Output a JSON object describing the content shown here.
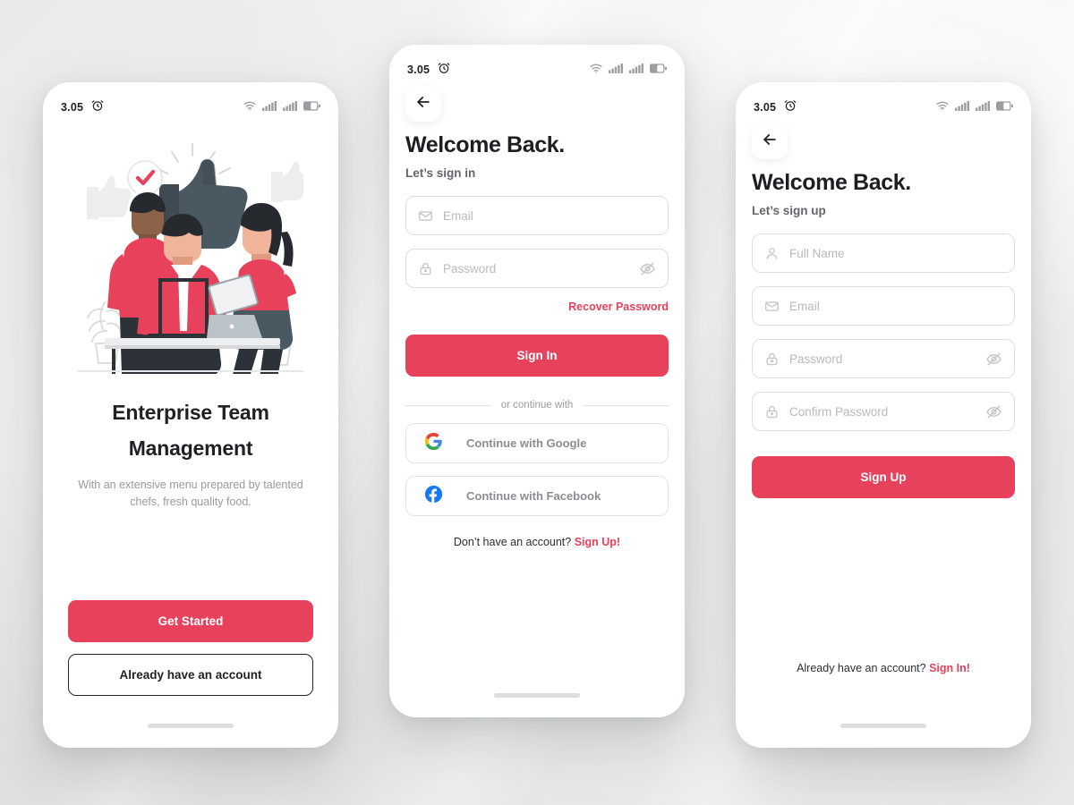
{
  "theme": {
    "accent": "#e8415c",
    "text_dark": "#1f2125",
    "text_muted": "#9a9a9f",
    "border": "#dedfe1",
    "background": "#ecedee"
  },
  "status_bar": {
    "time": "3.05",
    "alarm_icon": "alarm-clock-icon",
    "wifi_icon": "wifi-icon",
    "signal_icon_1": "signal-bars-icon",
    "signal_icon_2": "signal-bars-icon",
    "battery_icon": "battery-icon"
  },
  "onboarding": {
    "illustration": "team-collaboration-thumbs-up-illustration",
    "title": "Enterprise Team Management",
    "title_line_1": "Enterprise Team",
    "title_line_2": "Management",
    "subtitle": "With an extensive menu prepared by talented chefs, fresh quality food.",
    "primary_button": "Get Started",
    "secondary_button": "Already have an account"
  },
  "signin": {
    "back_icon": "arrow-left-icon",
    "title": "Welcome Back.",
    "subtitle": "Let’s sign in",
    "fields": [
      {
        "name": "email",
        "placeholder": "Email",
        "icon": "envelope-icon",
        "value": "",
        "has_eye": false
      },
      {
        "name": "password",
        "placeholder": "Password",
        "icon": "lock-icon",
        "value": "",
        "has_eye": true,
        "eye_icon": "eye-off-icon"
      }
    ],
    "recover_link": "Recover Password",
    "submit_button": "Sign In",
    "divider_text": "or continue with",
    "social": [
      {
        "name": "google",
        "label": "Continue with Google",
        "icon": "google-icon"
      },
      {
        "name": "facebook",
        "label": "Continue with Facebook",
        "icon": "facebook-icon"
      }
    ],
    "footer_text": "Don’t have an account? ",
    "footer_link": "Sign Up!"
  },
  "signup": {
    "back_icon": "arrow-left-icon",
    "title": "Welcome Back.",
    "subtitle": "Let’s sign up",
    "fields": [
      {
        "name": "full-name",
        "placeholder": "Full Name",
        "icon": "person-icon",
        "value": "",
        "has_eye": false
      },
      {
        "name": "email",
        "placeholder": "Email",
        "icon": "envelope-icon",
        "value": "",
        "has_eye": false
      },
      {
        "name": "password",
        "placeholder": "Password",
        "icon": "lock-icon",
        "value": "",
        "has_eye": true,
        "eye_icon": "eye-off-icon"
      },
      {
        "name": "confirm-password",
        "placeholder": "Confirm Password",
        "icon": "lock-icon",
        "value": "",
        "has_eye": true,
        "eye_icon": "eye-off-icon"
      }
    ],
    "submit_button": "Sign Up",
    "footer_text": "Already have an account? ",
    "footer_link": "Sign In!"
  }
}
